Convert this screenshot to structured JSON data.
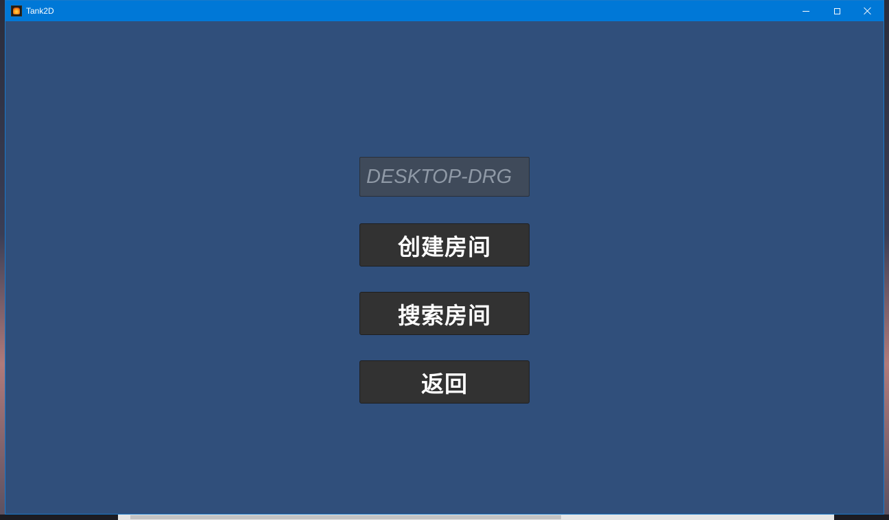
{
  "window": {
    "title": "Tank2D",
    "app_icon": "tank-flame-icon"
  },
  "titlebar_buttons": {
    "minimize": "minimize-icon",
    "maximize": "maximize-icon",
    "close": "close-icon"
  },
  "main": {
    "name_input_value": "DESKTOP-DRG",
    "buttons": {
      "create_room": "创建房间",
      "search_room": "搜索房间",
      "back": "返回"
    }
  },
  "colors": {
    "titlebar": "#0078d7",
    "background": "#304f7b",
    "button": "#323232",
    "input": "#3f4a5a"
  }
}
